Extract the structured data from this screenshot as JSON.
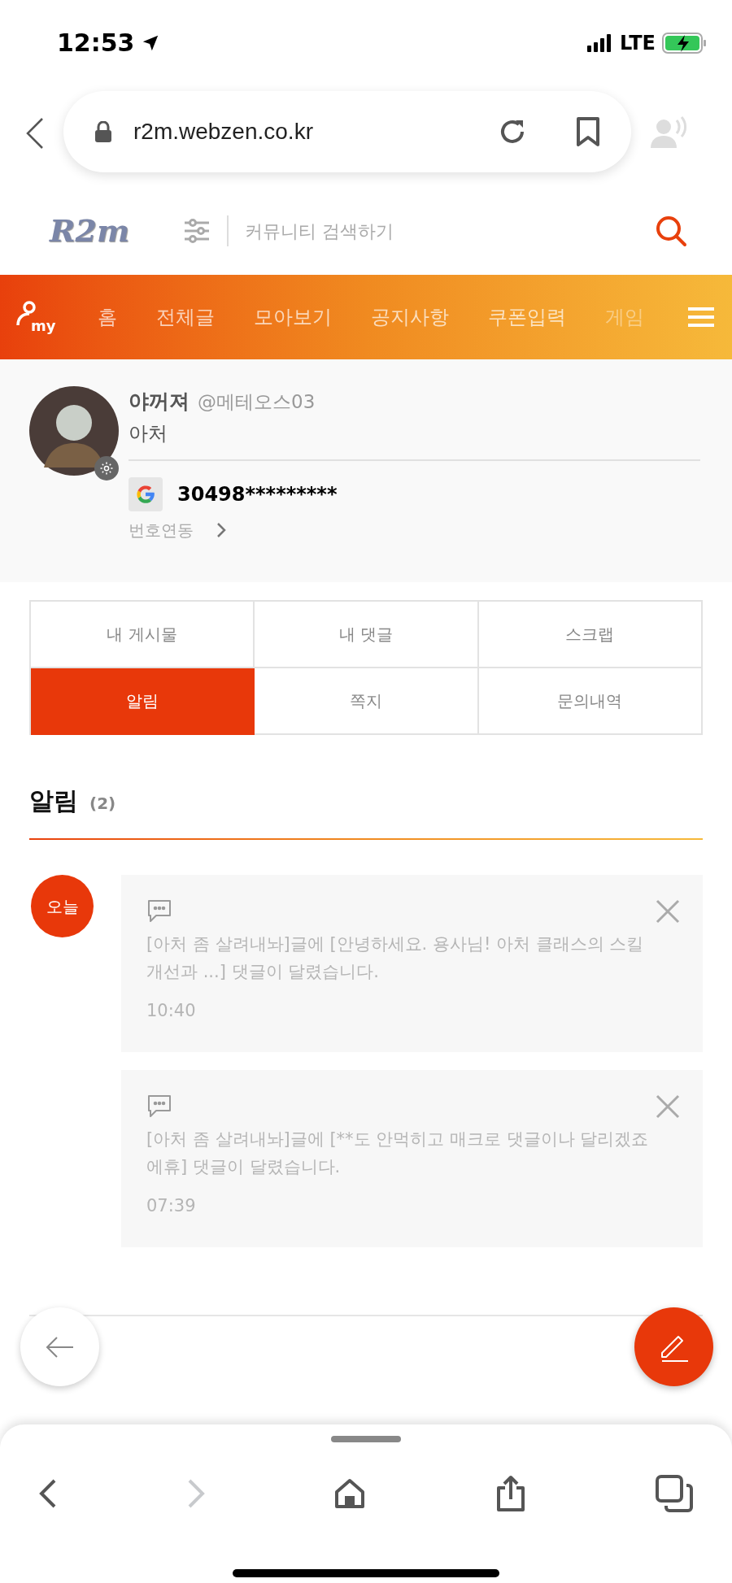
{
  "status_bar": {
    "time": "12:53",
    "network": "LTE"
  },
  "browser": {
    "url": "r2m.webzen.co.kr"
  },
  "site_header": {
    "logo": "R2m",
    "search": {
      "placeholder": "커뮤니티 검색하기"
    }
  },
  "nav": {
    "my_label": "my",
    "items": [
      {
        "label": "홈"
      },
      {
        "label": "전체글"
      },
      {
        "label": "모아보기"
      },
      {
        "label": "공지사항"
      },
      {
        "label": "쿠폰입력"
      },
      {
        "label": "게임"
      }
    ]
  },
  "profile": {
    "nickname": "야꺼져",
    "handle": "@메테오스03",
    "class": "아처",
    "account": "30498*********",
    "link_label": "번호연동"
  },
  "tabs": [
    {
      "label": "내 게시물",
      "selected": false
    },
    {
      "label": "내 댓글",
      "selected": false
    },
    {
      "label": "스크랩",
      "selected": false
    },
    {
      "label": "알림",
      "selected": true
    },
    {
      "label": "쪽지",
      "selected": false
    },
    {
      "label": "문의내역",
      "selected": false
    }
  ],
  "section": {
    "title": "알림",
    "count": "(2)"
  },
  "notifications": {
    "date_badge": "오늘",
    "items": [
      {
        "message": "[아처 좀 살려내놔]글에 [안녕하세요. 용사님! 아처 클래스의 스킬 개선과 ...] 댓글이 달렸습니다.",
        "time": "10:40"
      },
      {
        "message": "[아처 좀 살려내놔]글에 [**도 안먹히고 매크로 댓글이나 달리겠죠 에휴] 댓글이 달렸습니다.",
        "time": "07:39"
      }
    ]
  },
  "toolbar": {
    "forward_enabled": false
  }
}
